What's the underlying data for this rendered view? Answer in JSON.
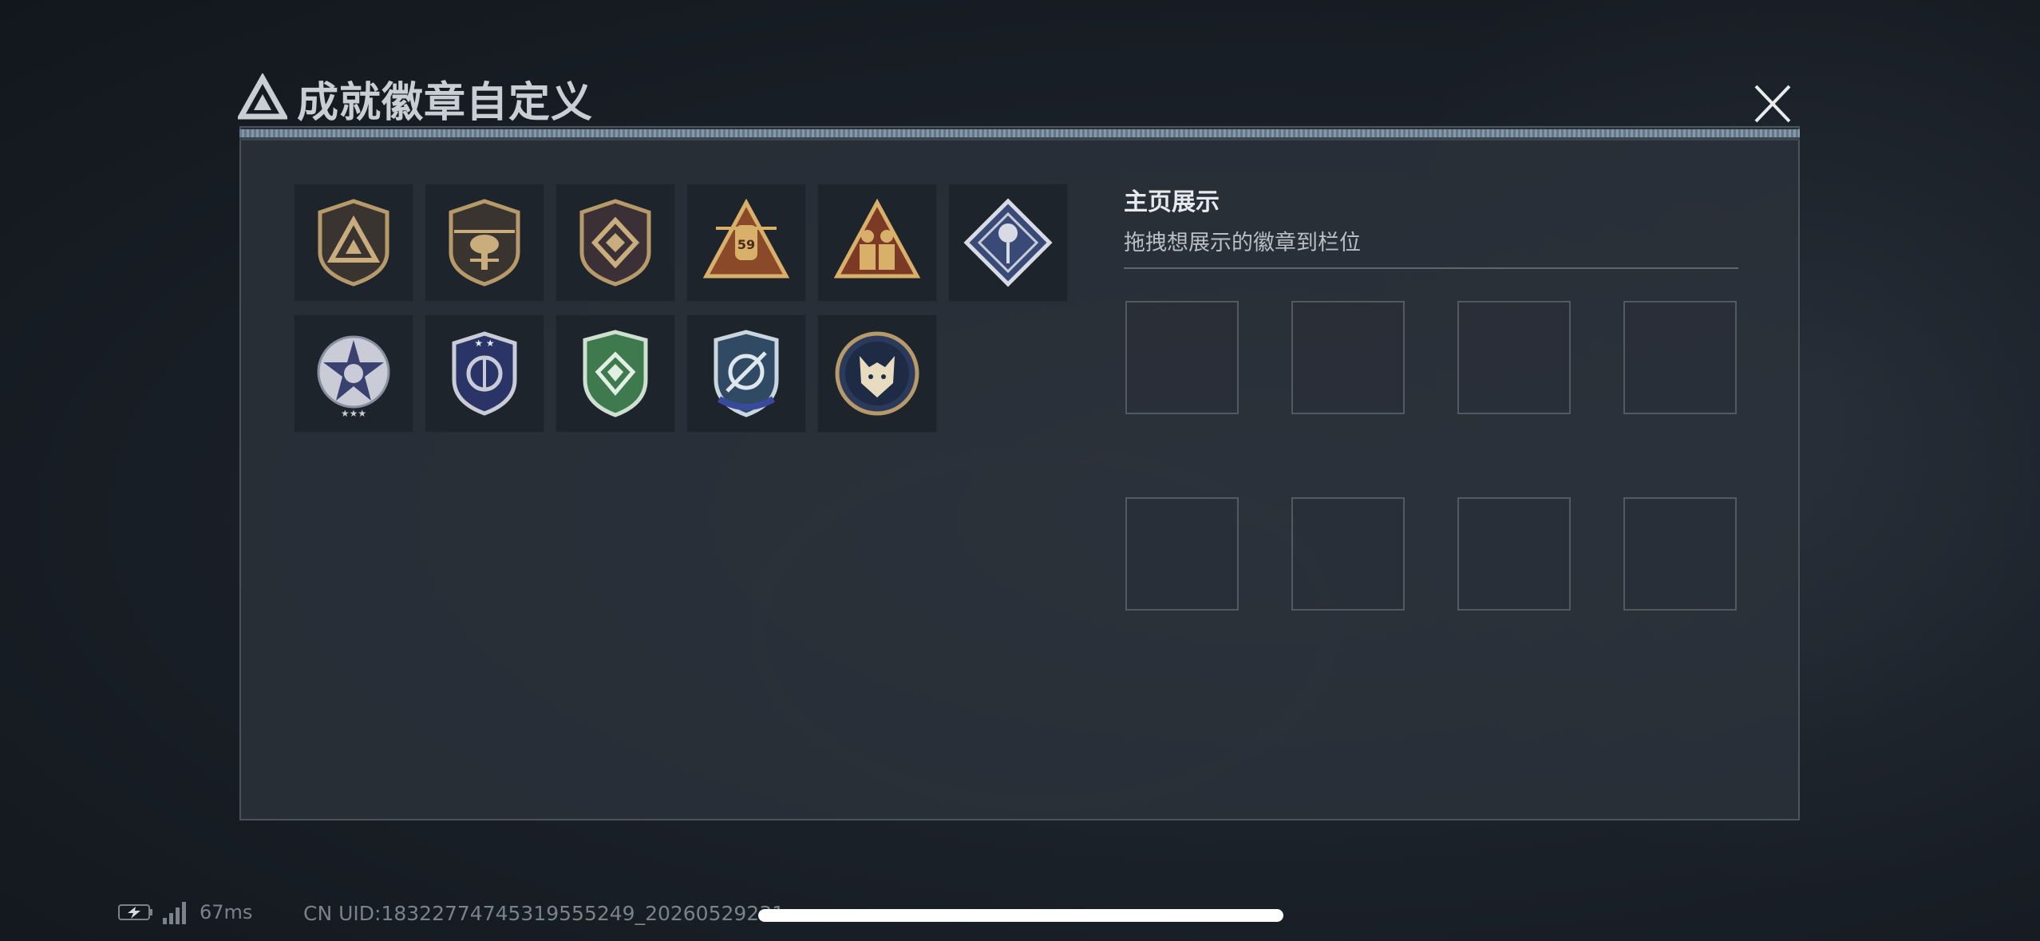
{
  "header": {
    "title": "成就徽章自定义"
  },
  "colors": {
    "accent": "#c9ced4",
    "panel": "#2c323a",
    "badge_gold": "#b79a6a",
    "badge_silver": "#c9ccd6",
    "badge_green": "#3f7a4f",
    "badge_navy": "#2b3466"
  },
  "badges": [
    {
      "icon": "gold-triangle-shield-icon"
    },
    {
      "icon": "helicopter-shield-icon"
    },
    {
      "icon": "diamond-emblem-shield-icon"
    },
    {
      "icon": "gold-bomb-triangle-icon",
      "label": "59"
    },
    {
      "icon": "gold-soldiers-triangle-icon"
    },
    {
      "icon": "silver-diamond-rose-icon"
    },
    {
      "icon": "silver-star-wreath-icon"
    },
    {
      "icon": "blue-shield-emblem-icon"
    },
    {
      "icon": "green-diamond-shield-icon"
    },
    {
      "icon": "blue-crosshair-shield-icon"
    },
    {
      "icon": "wolf-medallion-icon"
    }
  ],
  "showcase": {
    "title": "主页展示",
    "subtitle": "拖拽想展示的徽章到栏位",
    "slot_count": 8
  },
  "status_bar": {
    "ping": "67ms",
    "uid": "CN UID:18322774745319555249_20260529231"
  }
}
